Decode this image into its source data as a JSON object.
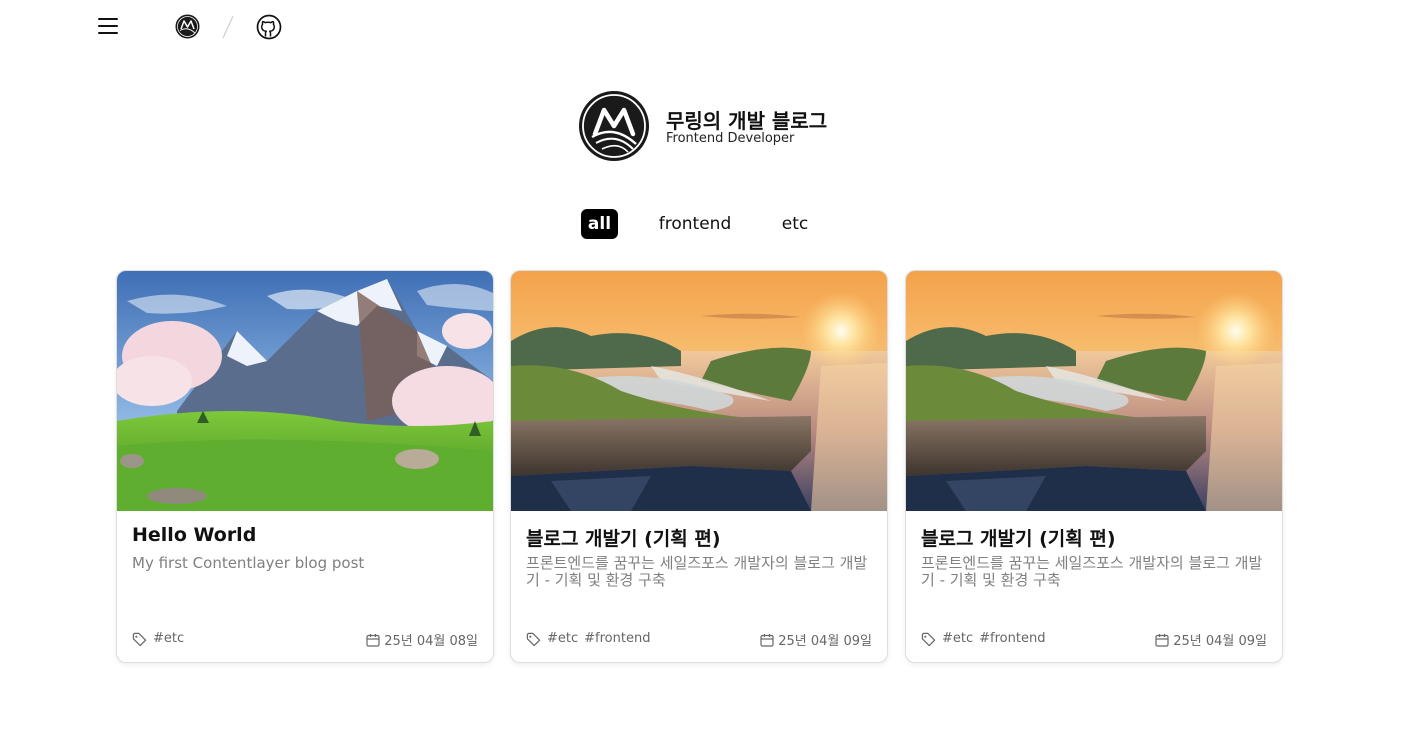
{
  "header": {
    "menu_icon": "menu-icon",
    "logo_icon": "monogram-m-logo-icon",
    "github_icon": "github-icon"
  },
  "profile": {
    "name": "무링의 개발 블로그",
    "role": "Frontend Developer"
  },
  "tabs": [
    {
      "label": "all",
      "active": true
    },
    {
      "label": "frontend",
      "active": false
    },
    {
      "label": "etc",
      "active": false
    }
  ],
  "posts": [
    {
      "title": "Hello World",
      "description": "My first Contentlayer blog post",
      "tags": [
        "#etc"
      ],
      "date": "25년 04월 08일",
      "image": "anime-mountain-meadow"
    },
    {
      "title": "블로그 개발기 (기획 편)",
      "description": "프론트엔드를 꿈꾸는 세일즈포스 개발자의 블로그 개발기 - 기획 및 환경 구축",
      "tags": [
        "#etc",
        "#frontend"
      ],
      "date": "25년 04월 09일",
      "image": "cliff-sunset-sea"
    },
    {
      "title": "블로그 개발기 (기획 편)",
      "description": "프론트엔드를 꿈꾸는 세일즈포스 개발자의 블로그 개발기 - 기획 및 환경 구축",
      "tags": [
        "#etc",
        "#frontend"
      ],
      "date": "25년 04월 09일",
      "image": "cliff-sunset-sea"
    }
  ],
  "colors": {
    "accent": "#000000",
    "muted_text": "#808080",
    "card_border": "#dedede"
  }
}
